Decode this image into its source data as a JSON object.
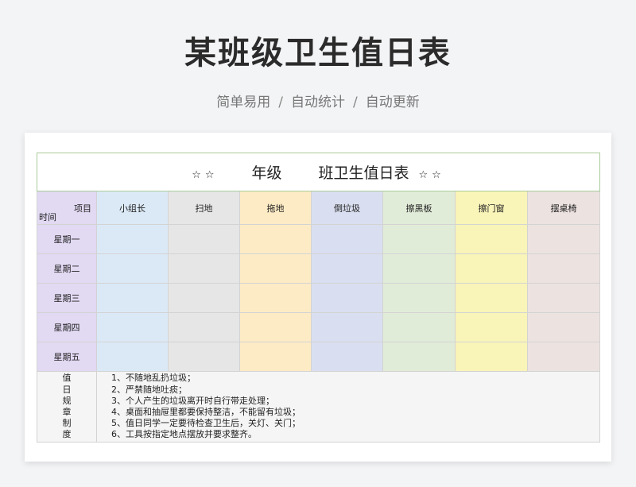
{
  "page": {
    "title": "某班级卫生值日表",
    "subtitle_parts": [
      "简单易用",
      "自动统计",
      "自动更新"
    ],
    "separator": "/"
  },
  "sheet": {
    "title_stars_left": "☆☆",
    "title_grade": "年级",
    "title_class": "班卫生值日表",
    "title_stars_right": "☆☆",
    "corner_top": "项目",
    "corner_bottom": "时间",
    "columns": [
      {
        "label": "小组长",
        "color": "#dbe9f6"
      },
      {
        "label": "扫地",
        "color": "#e6e6e6"
      },
      {
        "label": "拖地",
        "color": "#fdebc5"
      },
      {
        "label": "倒垃圾",
        "color": "#d9dff0"
      },
      {
        "label": "擦黑板",
        "color": "#e1ecd8"
      },
      {
        "label": "擦门窗",
        "color": "#f9f4b8"
      },
      {
        "label": "摆桌椅",
        "color": "#ece2e0"
      }
    ],
    "days": [
      "星期一",
      "星期二",
      "星期三",
      "星期四",
      "星期五"
    ],
    "rules_label": [
      "值",
      "日",
      "规",
      "章",
      "制",
      "度"
    ],
    "rules": [
      "1、不随地乱扔垃圾；",
      "2、严禁随地吐痰；",
      "3、个人产生的垃圾离开时自行带走处理；",
      "4、桌面和抽屉里都要保持整洁，不能留有垃圾；",
      "5、值日同学一定要待检查卫生后，关灯、关门；",
      "6、工具按指定地点摆放并要求整齐。"
    ]
  }
}
